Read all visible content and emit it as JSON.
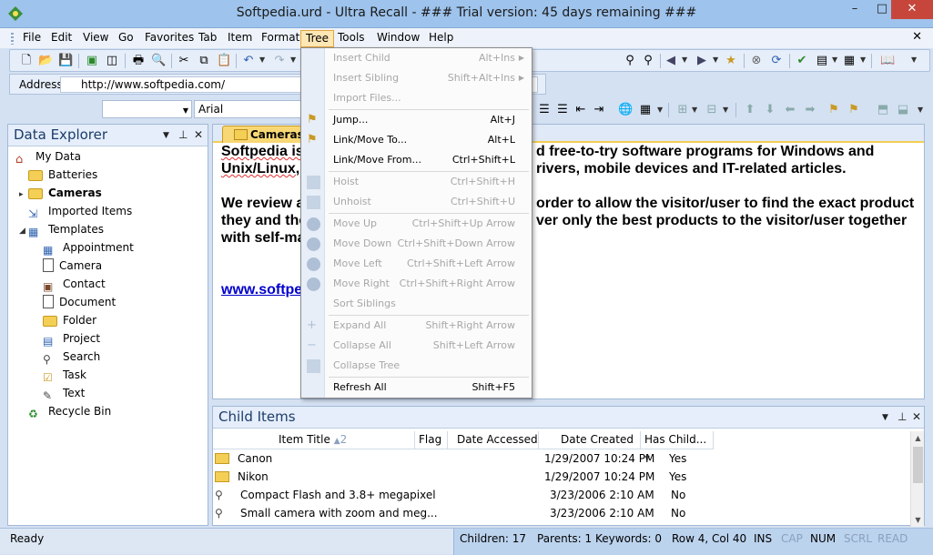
{
  "window": {
    "title": "Softpedia.urd - Ultra Recall - ### Trial version: 45 days remaining ###",
    "minimize": "–",
    "maximize": "□",
    "close": "✕"
  },
  "menubar": {
    "items": [
      "File",
      "Edit",
      "View",
      "Go",
      "Favorites",
      "Tab",
      "Item",
      "Format",
      "Tree",
      "Tools",
      "Window",
      "Help"
    ],
    "active": "Tree",
    "doc_close": "✕"
  },
  "address": {
    "label": "Address",
    "value": "http://www.softpedia.com/"
  },
  "format": {
    "style_value": "",
    "font_value": "Arial"
  },
  "explorer": {
    "title": "Data Explorer",
    "tree": [
      {
        "label": "My Data",
        "icon": "home-icon",
        "depth": 0
      },
      {
        "label": "Batteries",
        "icon": "folder-icon",
        "depth": 1
      },
      {
        "label": "Cameras",
        "icon": "folder-icon",
        "depth": 1,
        "selected": true
      },
      {
        "label": "Imported Items",
        "icon": "imported-icon",
        "depth": 1
      },
      {
        "label": "Templates",
        "icon": "templates-icon",
        "depth": 1
      },
      {
        "label": "Appointment",
        "icon": "calendar-icon",
        "depth": 2
      },
      {
        "label": "Camera",
        "icon": "document-icon",
        "depth": 2
      },
      {
        "label": "Contact",
        "icon": "contact-icon",
        "depth": 2
      },
      {
        "label": "Document",
        "icon": "document-icon",
        "depth": 2
      },
      {
        "label": "Folder",
        "icon": "folder-icon",
        "depth": 2
      },
      {
        "label": "Project",
        "icon": "project-icon",
        "depth": 2
      },
      {
        "label": "Search",
        "icon": "search-icon",
        "depth": 2
      },
      {
        "label": "Task",
        "icon": "task-icon",
        "depth": 2
      },
      {
        "label": "Text",
        "icon": "text-icon",
        "depth": 2
      },
      {
        "label": "Recycle Bin",
        "icon": "recycle-bin-icon",
        "depth": 1
      }
    ]
  },
  "document": {
    "tab": "Cameras",
    "left_lines": [
      "Softpedia is",
      "Unix/Linux,",
      "",
      "We review a",
      "they and the",
      "with self-ma"
    ],
    "right_lines": [
      "d free-to-try software programs for Windows and",
      "rivers, mobile devices and IT-related articles.",
      "",
      "order to allow the visitor/user to find the exact product",
      "ver only the best products to the visitor/user together",
      ""
    ],
    "link": "www.softpe"
  },
  "child_items": {
    "title": "Child Items",
    "columns": [
      "Item Title",
      "2",
      "Flag",
      "Date Accessed",
      "Date Created",
      "Has Child..."
    ],
    "rows": [
      {
        "title": "Canon",
        "icon": "folder-icon",
        "date_accessed": "1/29/2007 10:24 PM",
        "has_child": "Yes"
      },
      {
        "title": "Nikon",
        "icon": "folder-icon",
        "date_accessed": "1/29/2007 10:24 PM",
        "has_child": "Yes"
      },
      {
        "title": "Compact Flash and 3.8+ megapixel",
        "icon": "search-icon",
        "date_accessed": "3/23/2006 2:10 AM",
        "has_child": "No"
      },
      {
        "title": "Small camera with zoom and meg...",
        "icon": "search-icon",
        "date_accessed": "3/23/2006 2:10 AM",
        "has_child": "No"
      }
    ]
  },
  "tree_menu": {
    "items": [
      {
        "label": "Insert Child",
        "key": "Alt+Ins",
        "disabled": true,
        "submenu": true
      },
      {
        "label": "Insert Sibling",
        "key": "Shift+Alt+Ins",
        "disabled": true,
        "submenu": true
      },
      {
        "label": "Import Files...",
        "key": "",
        "disabled": true
      },
      {
        "label": "Jump...",
        "key": "Alt+J",
        "disabled": false
      },
      {
        "label": "Link/Move To...",
        "key": "Alt+L",
        "disabled": false
      },
      {
        "label": "Link/Move From...",
        "key": "Ctrl+Shift+L",
        "disabled": false
      },
      {
        "label": "Hoist",
        "key": "Ctrl+Shift+H",
        "disabled": true
      },
      {
        "label": "Unhoist",
        "key": "Ctrl+Shift+U",
        "disabled": true
      },
      {
        "label": "Move Up",
        "key": "Ctrl+Shift+Up Arrow",
        "disabled": true
      },
      {
        "label": "Move Down",
        "key": "Ctrl+Shift+Down Arrow",
        "disabled": true
      },
      {
        "label": "Move Left",
        "key": "Ctrl+Shift+Left Arrow",
        "disabled": true
      },
      {
        "label": "Move Right",
        "key": "Ctrl+Shift+Right Arrow",
        "disabled": true
      },
      {
        "label": "Sort Siblings",
        "key": "",
        "disabled": true
      },
      {
        "label": "Expand All",
        "key": "Shift+Right Arrow",
        "disabled": true
      },
      {
        "label": "Collapse All",
        "key": "Shift+Left Arrow",
        "disabled": true
      },
      {
        "label": "Collapse Tree",
        "key": "",
        "disabled": true
      },
      {
        "label": "Refresh All",
        "key": "Shift+F5",
        "disabled": false
      }
    ]
  },
  "status": {
    "ready": "Ready",
    "children": "Children: 17",
    "parents": "Parents: 1",
    "keywords": "Keywords: 0",
    "position": "Row 4, Col 40",
    "ins": "INS",
    "cap": "CAP",
    "num": "NUM",
    "scrl": "SCRL",
    "read": "READ"
  },
  "colors": {
    "title_bar": "#9ec3ec",
    "close_button": "#c7463c",
    "menu_active": "#fde7b4",
    "folder": "#f3cf55",
    "link": "#0000cc"
  }
}
